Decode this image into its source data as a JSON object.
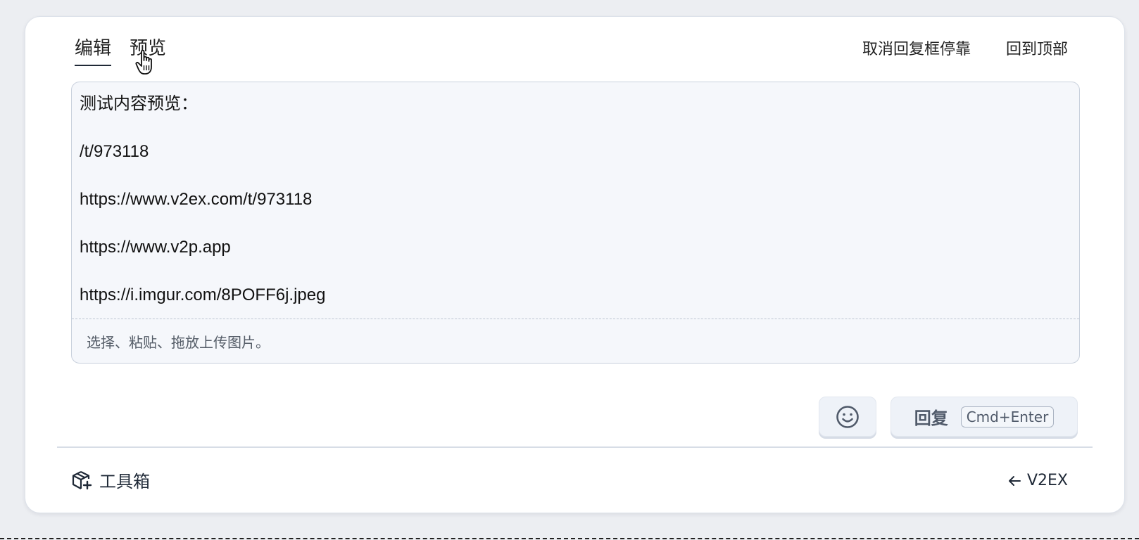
{
  "tabs": {
    "edit": "编辑",
    "preview": "预览"
  },
  "top_actions": {
    "undock": "取消回复框停靠",
    "back_to_top": "回到顶部"
  },
  "editor": {
    "lines": [
      "测试内容预览：",
      "/t/973118",
      "https://www.v2ex.com/t/973118",
      "https://www.v2p.app",
      "https://i.imgur.com/8POFF6j.jpeg"
    ],
    "upload_hint": "选择、粘贴、拖放上传图片。"
  },
  "buttons": {
    "emoji_icon": "smiley-icon",
    "reply_label": "回复",
    "reply_shortcut": "Cmd+Enter"
  },
  "footer": {
    "toolbox_icon": "package-plus-icon",
    "toolbox_label": "工具箱",
    "back_link": "V2EX"
  },
  "colors": {
    "page_bg": "#eceef2",
    "card_bg": "#ffffff",
    "editor_bg": "#f5f7fb",
    "button_bg": "#eef2f8",
    "button_text": "#505a6a"
  }
}
